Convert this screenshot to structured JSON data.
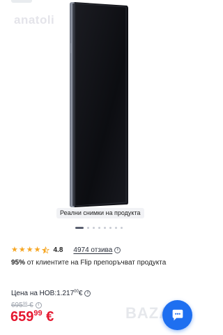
{
  "watermark": "anatoli",
  "gallery": {
    "caption": "Реални снимки на продукта",
    "dots_count": 8,
    "active_index": 0
  },
  "rating": {
    "value": "4.8",
    "stars": 4.5,
    "reviews_text": "4974 отзива",
    "info_icon": "info-icon"
  },
  "recommend": {
    "percent": "95%",
    "text": " от клиентите на Flip препоръчват продукта"
  },
  "new_price": {
    "label": "Цена на НОВ: ",
    "amount": "1.217",
    "cents": "00",
    "currency": " €"
  },
  "old_price": {
    "amount": "695",
    "cents": "99",
    "currency": " €"
  },
  "price": {
    "amount": "659",
    "cents": "99",
    "currency": " €"
  },
  "brand_watermark": "BAZAR",
  "chat_button": {
    "icon": "chat-icon"
  },
  "colors": {
    "accent_price": "#e5172f",
    "star": "#f6a623",
    "chat_fab": "#1e6ff0"
  }
}
